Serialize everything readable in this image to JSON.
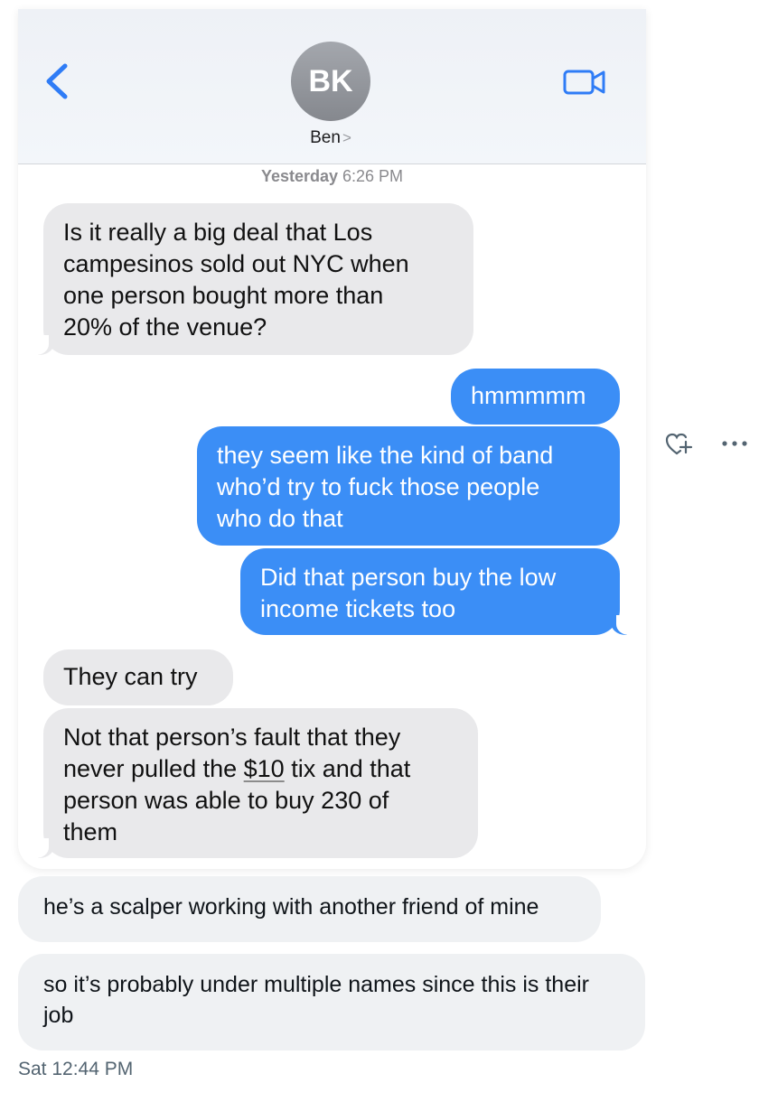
{
  "header": {
    "avatar_initials": "BK",
    "contact_name": "Ben",
    "contact_chevron": ">"
  },
  "thread": {
    "timestamp_day": "Yesterday",
    "timestamp_time": "6:26 PM",
    "messages": [
      {
        "direction": "incoming",
        "text": "Is it really a big deal that Los\ncampesinos sold out NYC when\none person bought more than\n20% of the venue?"
      },
      {
        "direction": "outgoing",
        "text": "hmmmmm"
      },
      {
        "direction": "outgoing",
        "text": "they seem like the kind of band\nwho’d try to fuck those people\nwho do that"
      },
      {
        "direction": "outgoing",
        "text": "Did that person buy the low\nincome tickets too"
      },
      {
        "direction": "incoming",
        "text": "They can try"
      },
      {
        "direction": "incoming",
        "text_before_link": "Not that person’s fault that they\nnever pulled the ",
        "link_text": "$10",
        "text_after_link": " tix and that\nperson was able to buy 230 of\nthem"
      }
    ]
  },
  "tweet": {
    "replies": [
      "he’s a scalper working with another friend of mine",
      "so it’s probably under multiple names since this is their job"
    ],
    "sent_time": "Sat 12:44 PM"
  },
  "icons": {
    "back": "chevron-left-icon",
    "video": "video-camera-icon",
    "react": "add-reaction-icon",
    "more": "more-dots-icon"
  },
  "colors": {
    "imessage_blue": "#3b8ef6",
    "incoming_gray": "#e9e9eb",
    "ios_link_blue": "#2f7cf6",
    "reply_gray": "#eff1f3"
  }
}
